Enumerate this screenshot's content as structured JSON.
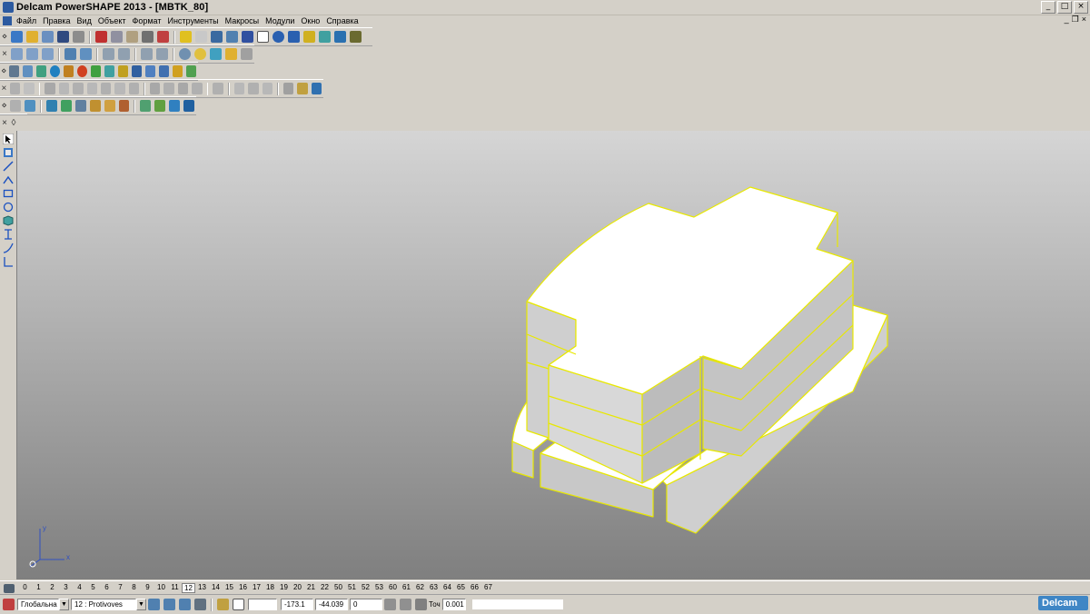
{
  "window": {
    "title": "Delcam PowerSHAPE 2013 - [MBTK_80]",
    "controls": [
      "_",
      "□",
      "×"
    ]
  },
  "menu": {
    "items": [
      "Файл",
      "Правка",
      "Вид",
      "Объект",
      "Формат",
      "Инструменты",
      "Макросы",
      "Модули",
      "Окно",
      "Справка"
    ],
    "mdi_controls": [
      "_",
      "❐",
      "×"
    ]
  },
  "toolbars": [
    {
      "handle": "⋄",
      "icon_count": 24
    },
    {
      "handle": "×",
      "icon_count": 16
    },
    {
      "handle": "⋄",
      "icon_count": 14
    },
    {
      "handle": "×",
      "icon_count": 20
    },
    {
      "handle": "⋄",
      "icon_count": 12
    },
    {
      "handle": "×",
      "icon_count": 0
    }
  ],
  "left_tools": [
    "select-icon",
    "layers-icon",
    "line-icon",
    "arc-icon",
    "rectangle-icon",
    "circle-icon",
    "solid-icon",
    "dimension-icon",
    "curve-icon",
    "corner-icon"
  ],
  "axis": {
    "y": "y",
    "x": "x"
  },
  "layers": {
    "numbers": [
      "0",
      "1",
      "2",
      "3",
      "4",
      "5",
      "6",
      "7",
      "8",
      "9",
      "10",
      "11",
      "12",
      "13",
      "14",
      "15",
      "16",
      "17",
      "18",
      "19",
      "20",
      "21",
      "22",
      "50",
      "51",
      "52",
      "53",
      "60",
      "61",
      "62",
      "63",
      "64",
      "65",
      "66",
      "67"
    ],
    "active": "12"
  },
  "status": {
    "workplane": "Глобальна",
    "layer": "12 : Protivoves",
    "x": "-173.1",
    "y": "-44.039",
    "z": "0",
    "tolerance_label": "Точ",
    "tolerance": "0.001",
    "message": ""
  },
  "brand": "Delcam",
  "colors": {
    "edge": "#e8e800",
    "face_top": "#ffffff",
    "face_side": "#d8d8d8"
  }
}
